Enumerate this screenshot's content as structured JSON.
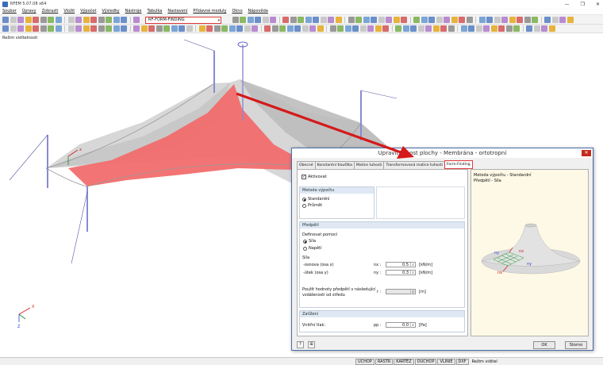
{
  "window": {
    "title": "RFEM 5.07.08 x64",
    "controls": [
      "—",
      "❐",
      "✕"
    ]
  },
  "menu": [
    "Soubor",
    "Úpravy",
    "Zobrazit",
    "Vložit",
    "Výpočet",
    "Výsledky",
    "Nástroje",
    "Tabulka",
    "Nastavení",
    "Přídavné moduly",
    "Okno",
    "Nápověda"
  ],
  "toolbar": {
    "load_case": "RF-FORM-FINDING"
  },
  "viewport": {
    "mode_label": "Režim vidítelnosti"
  },
  "status": {
    "toggles": [
      "UCHOP",
      "RASTR",
      "KARTÉZ",
      "OUCHOP",
      "VLINIE",
      "DXF"
    ],
    "text": "Režim viditel"
  },
  "dialog": {
    "title": "Upravit tuhost plochy - Membrána - ortotropní",
    "close": "✕",
    "tabs": [
      "Obecné",
      "Konstantní tloušťka",
      "Matice tuhosti",
      "Transformovaná matice tuhosti",
      "Form-Finding"
    ],
    "active_tab": "Form-Finding",
    "activate": {
      "label": "Aktivovat",
      "checked": true,
      "mark": "✓"
    },
    "method_group": {
      "title": "Metoda výpočtu",
      "options": [
        "Standardní",
        "Průmět"
      ],
      "selected": "Standardní"
    },
    "prestress_group": {
      "title": "Předpětí",
      "define_label": "Definovat pomocí",
      "define_options": [
        "Síla",
        "Napětí"
      ],
      "define_selected": "Síla",
      "force_label": "Síla",
      "rows": [
        {
          "label": "-osnova (osa x)",
          "symbol": "nx :",
          "value": "0.5",
          "unit": "[kN/m]"
        },
        {
          "label": "-útek (osa y)",
          "symbol": "ny :",
          "value": "0.3",
          "unit": "[kN/m]"
        }
      ],
      "radius_label_1": "Použít hodnoty předpětí v následující",
      "radius_label_2": "vzdálenosti od středu",
      "radius_symbol": "r :",
      "radius_unit": "[m]"
    },
    "load_group": {
      "title": "Zatížení",
      "label": "Vnitřní tlak:",
      "symbol": "pp :",
      "value": "0.0",
      "unit": "[Pa]"
    },
    "preview": {
      "line1": "Metoda výpočtu - Standardní",
      "line2": "Předpětí - Síla",
      "label_nx": "nx",
      "label_ny": "ny"
    },
    "buttons": {
      "ok": "OK",
      "cancel": "Storno"
    },
    "footer_icons": [
      "?",
      "⊞"
    ]
  },
  "colors": {
    "membrane_highlight": "#f26d6d",
    "membrane_gray": "#c8c8c8",
    "mast": "#8a8ad6",
    "arrow": "#d41a1a",
    "dialog_border": "#4a6da8",
    "preview_bg": "#fdf9e6"
  }
}
